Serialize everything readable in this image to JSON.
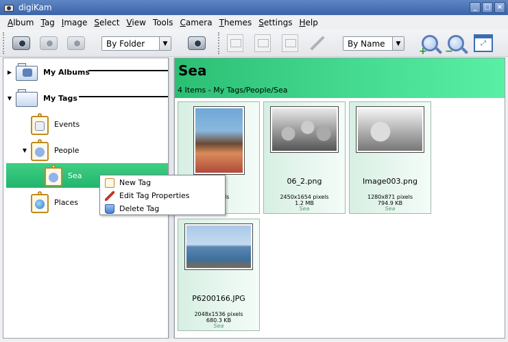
{
  "window": {
    "title": "digiKam"
  },
  "menubar": [
    {
      "label": "Album",
      "u": "A",
      "rest": "lbum"
    },
    {
      "label": "Tag",
      "u": "T",
      "rest": "ag"
    },
    {
      "label": "Image",
      "u": "I",
      "rest": "mage"
    },
    {
      "label": "Select",
      "u": "S",
      "rest": "elect"
    },
    {
      "label": "View",
      "u": "V",
      "rest": "iew"
    },
    {
      "label": "Tools",
      "u": "",
      "rest": "Tools"
    },
    {
      "label": "Camera",
      "u": "C",
      "rest": "amera"
    },
    {
      "label": "Themes",
      "u": "T",
      "rest": "hemes"
    },
    {
      "label": "Settings",
      "u": "S",
      "rest": "ettings"
    },
    {
      "label": "Help",
      "u": "H",
      "rest": "elp"
    }
  ],
  "toolbar": {
    "view_combo": "By Folder",
    "sort_combo": "By Name"
  },
  "tree": {
    "my_albums": "My Albums",
    "my_tags": "My Tags",
    "events": "Events",
    "people": "People",
    "sea": "Sea",
    "places": "Places"
  },
  "banner": {
    "title": "Sea",
    "subtitle": "4 Items - My Tags/People/Sea"
  },
  "thumbnails": [
    {
      "name": "...G",
      "dims": "...pixels",
      "size": "...KB",
      "tag": ""
    },
    {
      "name": "06_2.png",
      "dims": "2450x1654 pixels",
      "size": "1.2 MB",
      "tag": "Sea"
    },
    {
      "name": "Image003.png",
      "dims": "1280x871 pixels",
      "size": "794.9 KB",
      "tag": "Sea"
    },
    {
      "name": "P6200166.JPG",
      "dims": "2048x1536 pixels",
      "size": "680.3 KB",
      "tag": "Sea"
    }
  ],
  "context_menu": {
    "new_tag": "New Tag",
    "edit_tag": "Edit Tag Properties",
    "delete_tag": "Delete Tag"
  }
}
